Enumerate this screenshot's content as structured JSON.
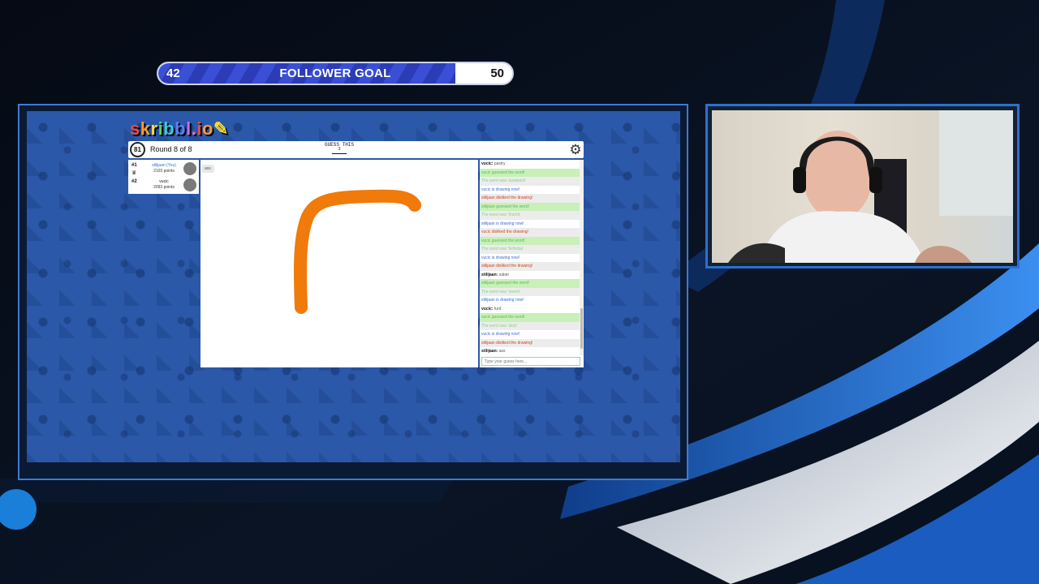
{
  "overlay": {
    "goal_title": "FOLLOWER GOAL",
    "goal_current": "42",
    "goal_target": "50",
    "goal_progress": 0.84,
    "accent_color": "#2f6fd0"
  },
  "game": {
    "logo": [
      "s",
      "k",
      "r",
      "i",
      "b",
      "b",
      "l",
      ".",
      "i",
      "o"
    ],
    "timer": "81",
    "round": "Round 8 of 8",
    "guess_label": "GUESS THIS",
    "guess_length": "3",
    "players": [
      {
        "rank": "#1",
        "name": "stilijaan (You)",
        "points": "2103 points"
      },
      {
        "rank": "#2",
        "name": "vucic",
        "points": "2093 points"
      }
    ],
    "bubble": "ass",
    "chat": [
      {
        "who": "vucic: ",
        "text": "pastry",
        "kind": "msg"
      },
      {
        "who": "",
        "text": "vucic guessed the word!",
        "kind": "green"
      },
      {
        "who": "",
        "text": "The word was 'sandwich'",
        "kind": "lightgreen"
      },
      {
        "who": "",
        "text": "vucic is drawing now!",
        "kind": "blue"
      },
      {
        "who": "",
        "text": "stilijaan disliked the drawing!",
        "kind": "red"
      },
      {
        "who": "",
        "text": "stilijaan guessed the word!",
        "kind": "green"
      },
      {
        "who": "",
        "text": "The word was 'thumb'",
        "kind": "lightgreen"
      },
      {
        "who": "",
        "text": "stilijaan is drawing now!",
        "kind": "blue"
      },
      {
        "who": "",
        "text": "vucic disliked the drawing!",
        "kind": "red"
      },
      {
        "who": "",
        "text": "vucic guessed the word!",
        "kind": "green"
      },
      {
        "who": "",
        "text": "The word was 'birthday'",
        "kind": "lightgreen"
      },
      {
        "who": "",
        "text": "vucic is drawing now!",
        "kind": "blue"
      },
      {
        "who": "",
        "text": "stilijaan disliked the drawing!",
        "kind": "red"
      },
      {
        "who": "stilijaan: ",
        "text": "saber",
        "kind": "msg"
      },
      {
        "who": "",
        "text": "stilijaan guessed the word!",
        "kind": "green"
      },
      {
        "who": "",
        "text": "The word was 'sword'",
        "kind": "lightgreen"
      },
      {
        "who": "",
        "text": "stilijaan is drawing now!",
        "kind": "blue"
      },
      {
        "who": "vucic: ",
        "text": "turd",
        "kind": "msg"
      },
      {
        "who": "",
        "text": "vucic guessed the word!",
        "kind": "green"
      },
      {
        "who": "",
        "text": "The word was 'stick'",
        "kind": "lightgreen"
      },
      {
        "who": "",
        "text": "vucic is drawing now!",
        "kind": "blue"
      },
      {
        "who": "",
        "text": "stilijaan disliked the drawing!",
        "kind": "red"
      },
      {
        "who": "stilijaan: ",
        "text": "ass",
        "kind": "msg"
      }
    ],
    "chat_placeholder": "Type your guess here...",
    "stroke_color": "#f07a0a"
  }
}
